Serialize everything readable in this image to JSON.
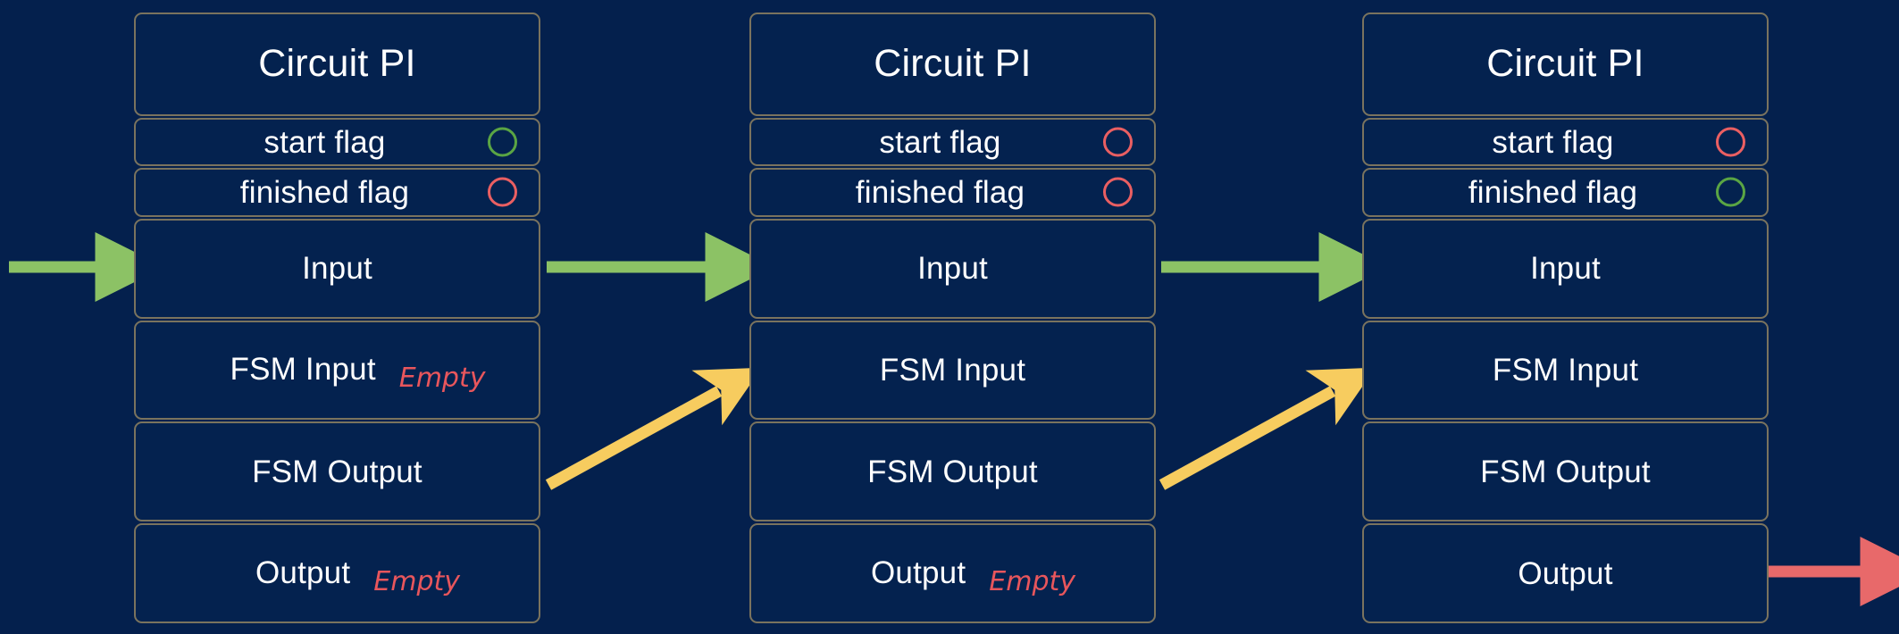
{
  "background_color": "#04204d",
  "colors": {
    "panel_border": "#7a735e",
    "panel_fill": "#04224f",
    "label_text": "#ffffff",
    "flag_on": "#5aa544",
    "flag_off": "#ea5f62",
    "arrow_green": "#8cc265",
    "arrow_yellow": "#f7cc5f",
    "arrow_red": "#e8696a",
    "empty_tag": "#e8565c"
  },
  "section_labels": {
    "title": "Circuit PI",
    "start_flag": "start flag",
    "finished_flag": "finished flag",
    "input": "Input",
    "fsm_input": "FSM Input",
    "fsm_output": "FSM Output",
    "output": "Output"
  },
  "empty_tag_label": "Empty",
  "panels": [
    {
      "title": "Circuit PI",
      "start_flag": {
        "label": "start flag",
        "state": "green"
      },
      "finished_flag": {
        "label": "finished flag",
        "state": "red"
      },
      "input": {
        "label": "Input",
        "tag": ""
      },
      "fsm_input": {
        "label": "FSM Input",
        "tag": "Empty"
      },
      "fsm_output": {
        "label": "FSM Output",
        "tag": ""
      },
      "output": {
        "label": "Output",
        "tag": "Empty"
      }
    },
    {
      "title": "Circuit PI",
      "start_flag": {
        "label": "start flag",
        "state": "red"
      },
      "finished_flag": {
        "label": "finished flag",
        "state": "red"
      },
      "input": {
        "label": "Input",
        "tag": ""
      },
      "fsm_input": {
        "label": "FSM Input",
        "tag": ""
      },
      "fsm_output": {
        "label": "FSM Output",
        "tag": ""
      },
      "output": {
        "label": "Output",
        "tag": "Empty"
      }
    },
    {
      "title": "Circuit PI",
      "start_flag": {
        "label": "start flag",
        "state": "red"
      },
      "finished_flag": {
        "label": "finished flag",
        "state": "green"
      },
      "input": {
        "label": "Input",
        "tag": ""
      },
      "fsm_input": {
        "label": "FSM Input",
        "tag": ""
      },
      "fsm_output": {
        "label": "FSM Output",
        "tag": ""
      },
      "output": {
        "label": "Output",
        "tag": ""
      }
    }
  ],
  "arrows": [
    {
      "name": "entry-input-arrow",
      "color": "#8cc265",
      "kind": "horizontal"
    },
    {
      "name": "input-arrow-panel1-to-panel2",
      "color": "#8cc265",
      "kind": "horizontal"
    },
    {
      "name": "input-arrow-panel2-to-panel3",
      "color": "#8cc265",
      "kind": "horizontal"
    },
    {
      "name": "fsm-arrow-panel1-to-panel2",
      "color": "#f7cc5f",
      "kind": "diagonal"
    },
    {
      "name": "fsm-arrow-panel2-to-panel3",
      "color": "#f7cc5f",
      "kind": "diagonal"
    },
    {
      "name": "exit-output-arrow",
      "color": "#e8696a",
      "kind": "horizontal"
    }
  ]
}
